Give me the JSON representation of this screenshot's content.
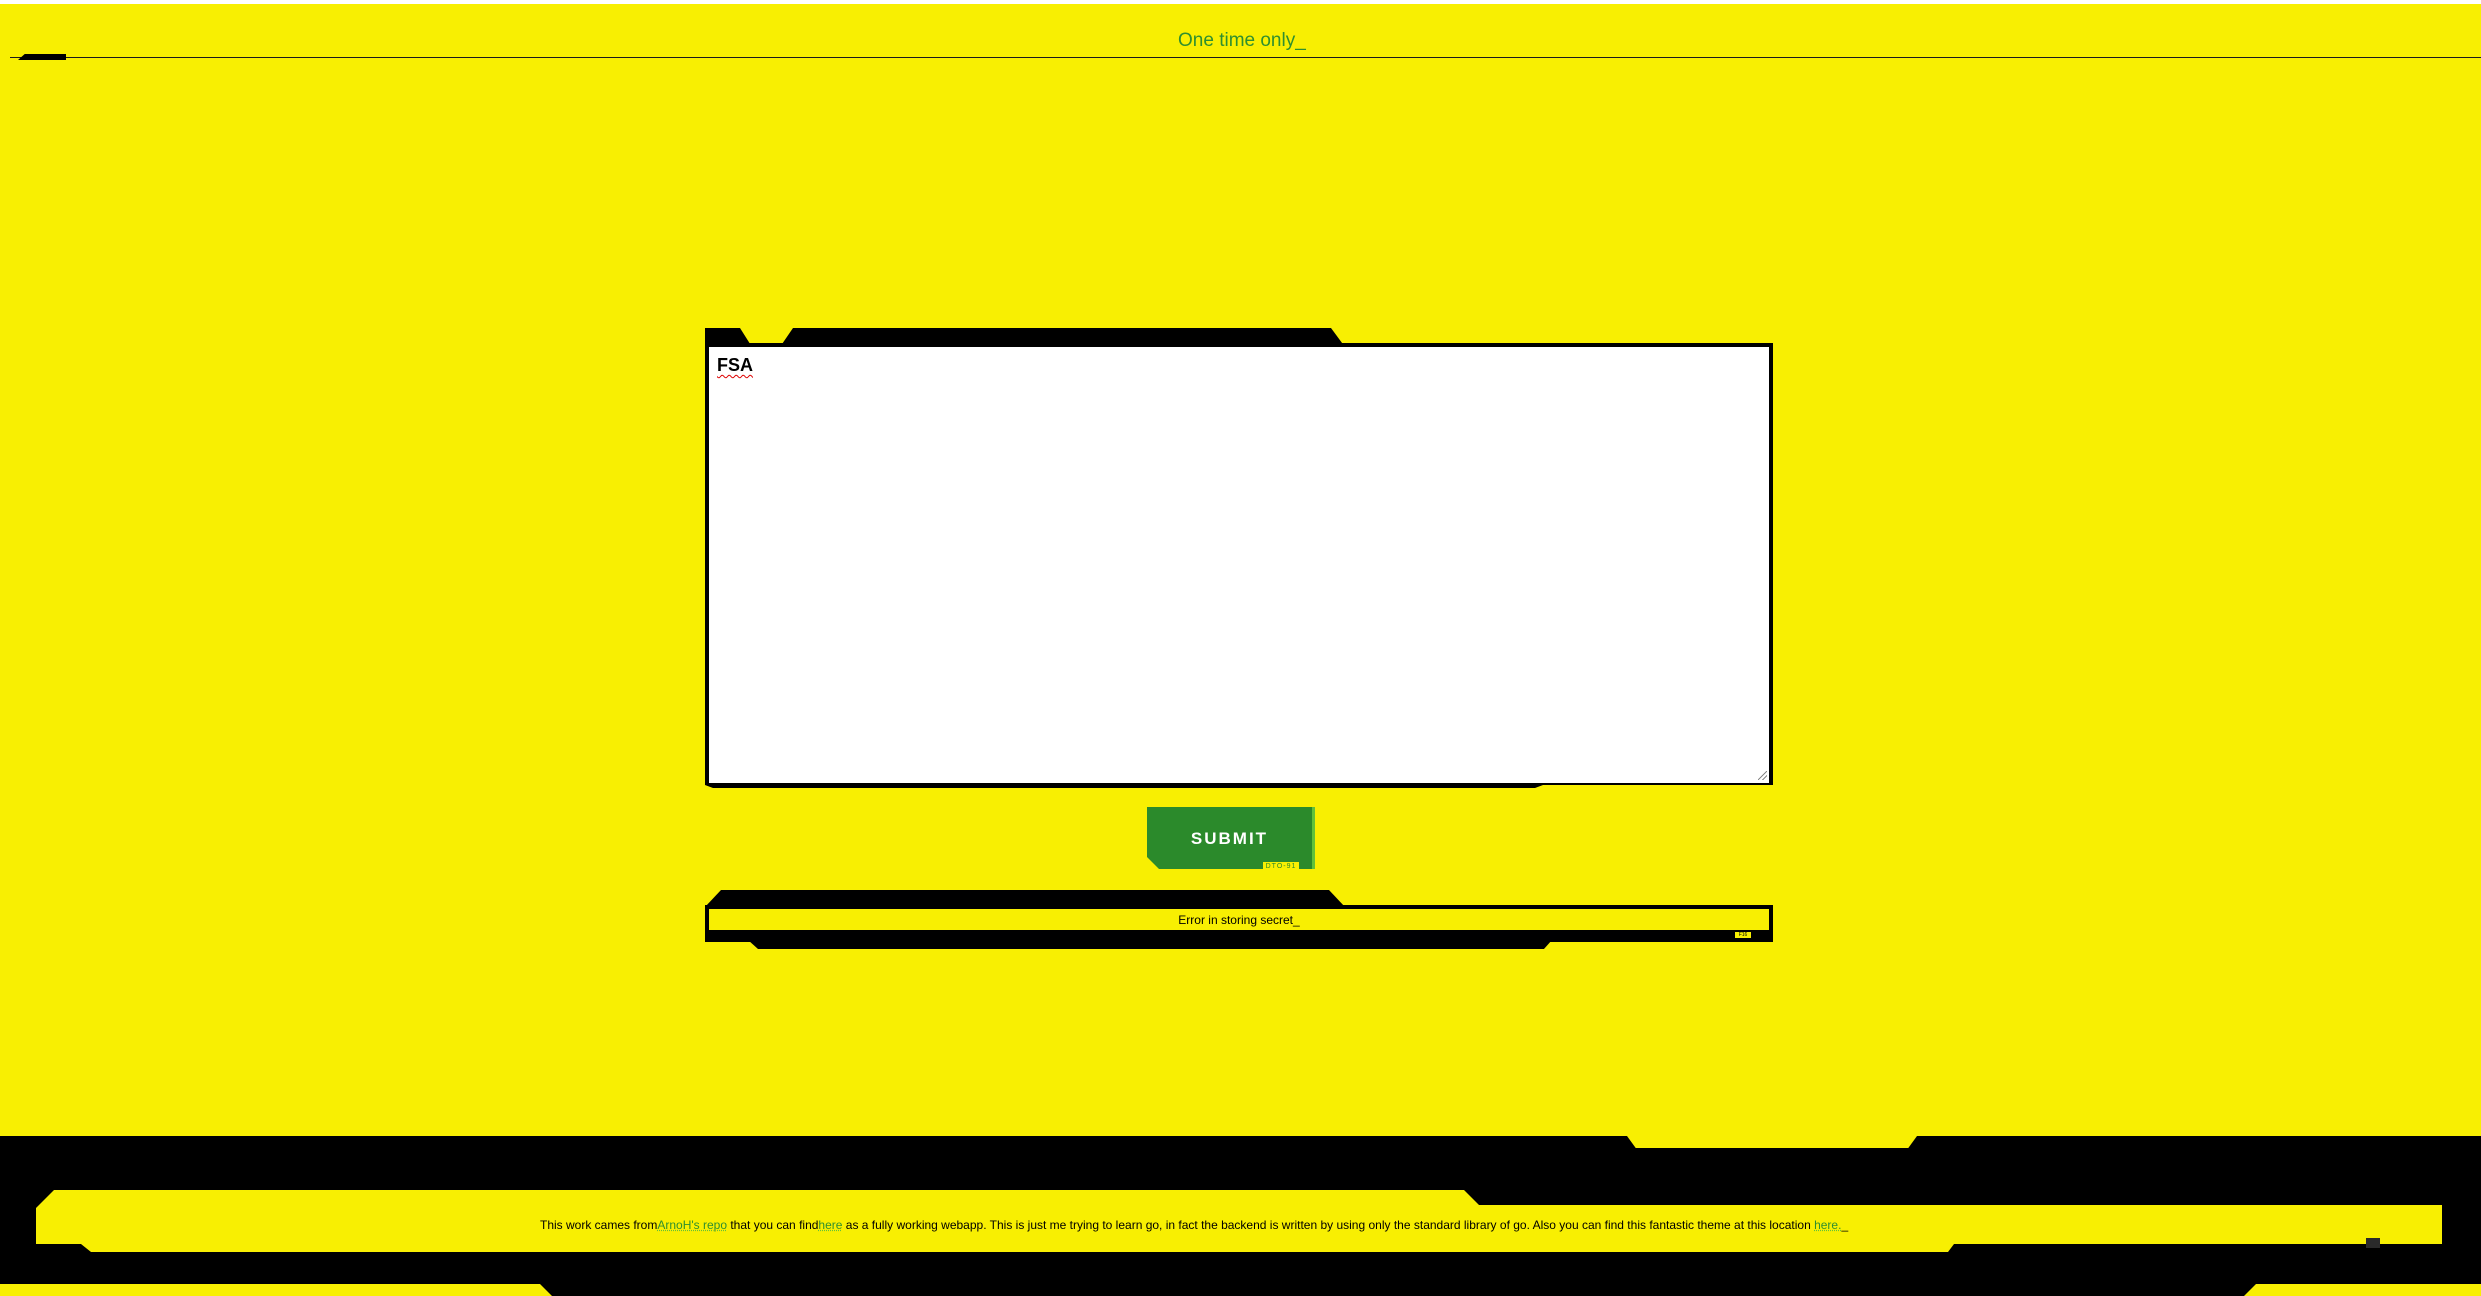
{
  "header": {
    "title": "One time only_"
  },
  "form": {
    "secret_text": "FSA",
    "submit_label": "SUBMIT",
    "submit_tag": "DTO-91"
  },
  "status": {
    "message": "Error in storing secret_",
    "tag": "F16"
  },
  "footer": {
    "text_1": "This work cames from",
    "link_1": "ArnoH's repo",
    "text_2": " that you can find",
    "link_2": "here",
    "text_3": " as a fully working webapp. This is just me trying to learn go, in fact the backend is written by using only the standard library of go. Also you can find this fantastic theme at this location ",
    "link_3": "here.",
    "text_4": "_"
  },
  "colors": {
    "background": "#f8ef02",
    "accent_green": "#2b8a2b",
    "link_green": "#2f8f2f",
    "frame": "#000000"
  }
}
